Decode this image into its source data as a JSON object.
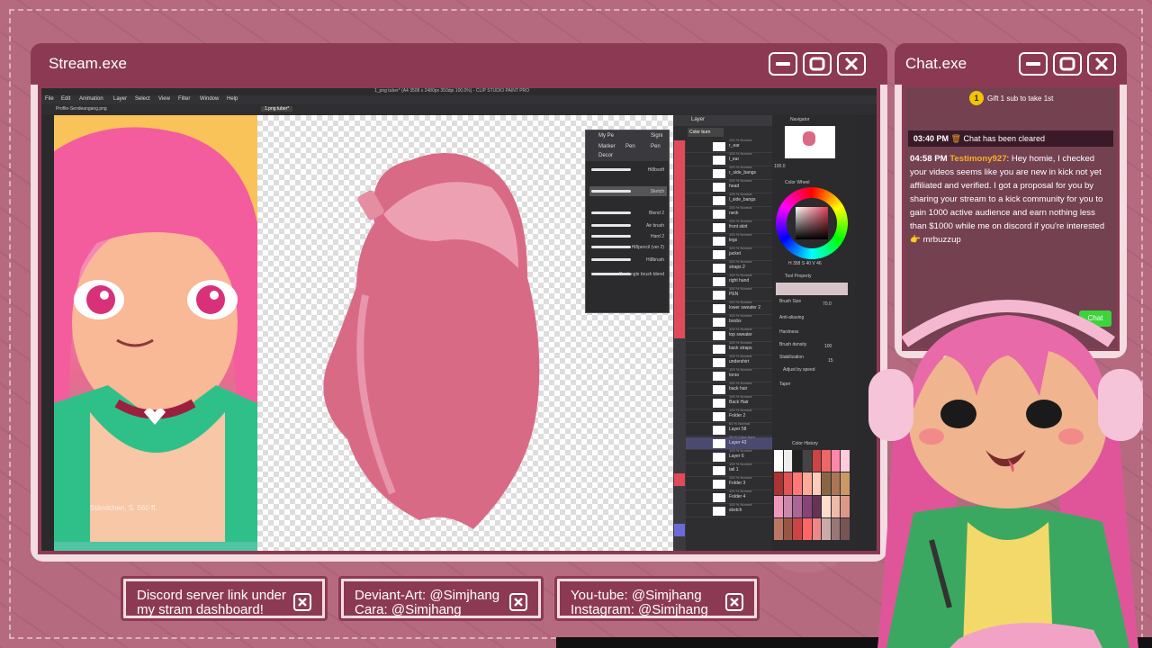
{
  "stream_window": {
    "title": "Stream.exe",
    "app": {
      "title": "1_png tuber* (A4 3508 x 2480px 350dpi 100.0%) - CLIP STUDIO PAINT PRO",
      "menu": [
        "File",
        "Edit",
        "Animation",
        "Layer",
        "Select",
        "View",
        "Filter",
        "Window",
        "Help"
      ],
      "ref_tab": "Profile-Sendeangang.png",
      "canvas_tab": "1.png tuber*",
      "ref_caption": "Ständchen, S. 560 ff.",
      "brush_popup": {
        "tabs": [
          "My Pe",
          "Signi",
          "Marker",
          "Pen",
          "Pen",
          "Decor"
        ],
        "brushes": [
          "Hi8bsoft",
          "Sketch",
          "Blend 2",
          "Air brush",
          "Hard 2",
          "Hi8pencil (ver 2)",
          "Hi8brush",
          "Rectangle brush blend"
        ]
      },
      "layers": [
        {
          "mode": "100 % Normal",
          "name": "r_ear"
        },
        {
          "mode": "100 % Normal",
          "name": "l_ear"
        },
        {
          "mode": "100 % Normal",
          "name": "r_side_bangs"
        },
        {
          "mode": "100 % Normal",
          "name": "head"
        },
        {
          "mode": "100 % Normal",
          "name": "l_side_bangs"
        },
        {
          "mode": "100 % Normal",
          "name": "neck"
        },
        {
          "mode": "100 % Normal",
          "name": "front skirt"
        },
        {
          "mode": "100 % Normal",
          "name": "legs"
        },
        {
          "mode": "100 % Normal",
          "name": "jacket"
        },
        {
          "mode": "100 % Normal",
          "name": "straps 2"
        },
        {
          "mode": "100 % Normal",
          "name": "right hand"
        },
        {
          "mode": "100 % Normal",
          "name": "PEN"
        },
        {
          "mode": "100 % Normal",
          "name": "lower sweater 2"
        },
        {
          "mode": "100 % Normal",
          "name": "boobs"
        },
        {
          "mode": "100 % Normal",
          "name": "top sweater"
        },
        {
          "mode": "100 % Normal",
          "name": "back straps"
        },
        {
          "mode": "100 % Normal",
          "name": "undershirt"
        },
        {
          "mode": "100 % Normal",
          "name": "torso"
        },
        {
          "mode": "100 % Normal",
          "name": "back hair"
        },
        {
          "mode": "100 % Normal",
          "name": "Back Hair"
        },
        {
          "mode": "100 % Normal",
          "name": "Folder 2"
        },
        {
          "mode": "60 % Normal",
          "name": "Layer 58"
        },
        {
          "mode": "25 % Color burn",
          "name": "Layer 43"
        },
        {
          "mode": "100 % Normal",
          "name": "Layer 6"
        },
        {
          "mode": "100 % Normal",
          "name": "tail 1"
        },
        {
          "mode": "100 % Normal",
          "name": "Folder 3"
        },
        {
          "mode": "100 % Normal",
          "name": "Folder 4"
        },
        {
          "mode": "100 % Normal",
          "name": "sketch"
        }
      ],
      "layer_tab": "Layer",
      "blend_mode": "Color burn",
      "props": {
        "navigator": "Navigator",
        "color_wheel": "Color Wheel",
        "tool_property": "Tool Property",
        "brush_size_label": "Brush Size",
        "brush_size": "70.0",
        "anti_aliasing": "Anti-aliasing",
        "hardness": "Hardness",
        "brush_density_label": "Brush density",
        "brush_density": "100",
        "stabilization_label": "Stabilization",
        "stabilization": "15",
        "adjust_speed": "Adjust by speed",
        "taper": "Taper",
        "color_history": "Color History",
        "zoom": "100.0",
        "hsv": "H 358  S 40  V 46"
      }
    }
  },
  "chat_window": {
    "title": "Chat.exe",
    "gift_badge": "1",
    "gift_text": "Gift 1 sub to take 1st",
    "cleared": {
      "time": "03:40 PM",
      "icon": "trash-icon",
      "text": "Chat has been cleared"
    },
    "message": {
      "time": "04:58 PM",
      "user": "Testimony927",
      "text": ": Hey homie, I checked your videos seems like you are new in kick not yet affiliated and verified. I got a proposal for you by sharing your stream to a kick community for you to gain 1000 active audience and earn nothing less than $1000 while me on discord if you're interested",
      "emoji": "👉",
      "handle": "mrbuzzup"
    },
    "chat_button": "Chat"
  },
  "info_boxes": [
    {
      "line1": "Discord server link under",
      "line2": "my stram dashboard!"
    },
    {
      "line1": "Deviant-Art: @Simjhang",
      "line2": "Cara: @Simjhang"
    },
    {
      "line1": "You-tube: @Simjhang",
      "line2": "Instagram: @Simjhang"
    }
  ],
  "colors": {
    "background": "#b56a80",
    "window_frame": "#8c3a53",
    "window_fill": "#f3dde2",
    "chat_user": "#f7b024",
    "chat_button": "#3cd43c"
  }
}
